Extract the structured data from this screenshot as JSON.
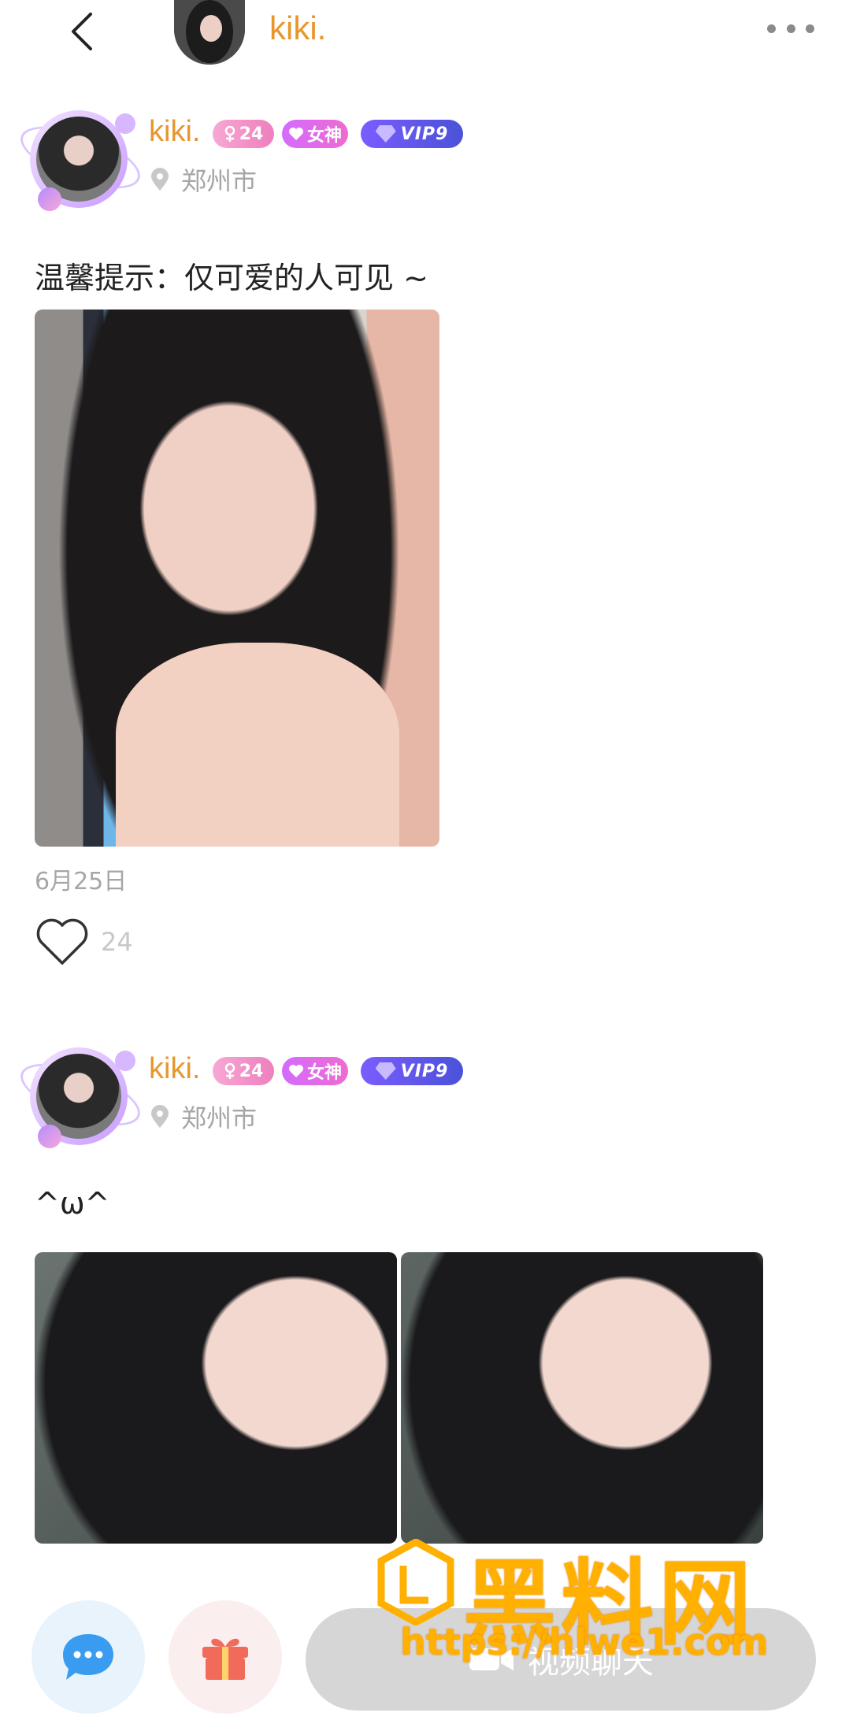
{
  "header": {
    "title": "kiki."
  },
  "posts": [
    {
      "user": {
        "name": "kiki.",
        "age": "24",
        "goddess_badge": "女神",
        "vip_badge": "VIP9",
        "location": "郑州市"
      },
      "text": "温馨提示：仅可爱的人可见 ~",
      "date": "6月25日",
      "likes": "24"
    },
    {
      "user": {
        "name": "kiki.",
        "age": "24",
        "goddess_badge": "女神",
        "vip_badge": "VIP9",
        "location": "郑州市"
      },
      "text": "^ω^"
    }
  ],
  "bottom_bar": {
    "video_chat_label": "视频聊天"
  },
  "watermark": {
    "title": "黑料网",
    "url": "https://hlwe1.com"
  },
  "colors": {
    "accent_name": "#e8962c",
    "badge_age": "#ef7fbd",
    "badge_goddess": "#d46bff",
    "badge_vip": "#5a52e0",
    "watermark": "#ffb000"
  }
}
